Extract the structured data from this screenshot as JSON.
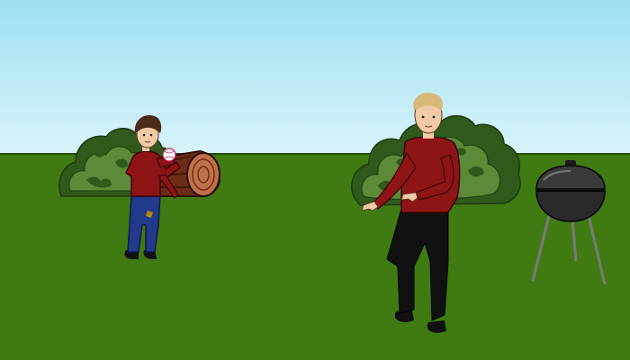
{
  "scene": {
    "description_elements": [
      "sky",
      "lawn",
      "left-bush",
      "tree-log",
      "boy-with-ball",
      "right-bush",
      "man-catching",
      "charcoal-grill"
    ],
    "colors": {
      "sky_top": "#9ee0f2",
      "sky_bottom": "#d9f4fa",
      "grass": "#3f7b12",
      "bush_dark": "#2f5a1c",
      "bush_light": "#5c8a38",
      "log_bark": "#6e2b16",
      "log_end": "#c0714a",
      "shirt_red": "#8e1515",
      "jeans_blue": "#223a8c",
      "pants_black": "#111111",
      "skin": "#f3c9a6",
      "hair_brown": "#4a2c18",
      "hair_blond": "#d8b878",
      "grill_black": "#2a2a2a",
      "grill_legs": "#7a7a7a"
    }
  }
}
